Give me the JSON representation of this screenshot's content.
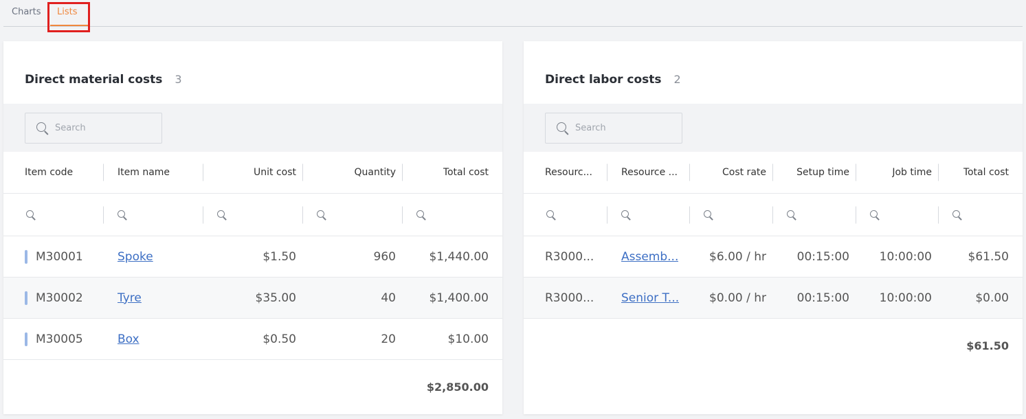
{
  "tabs": [
    {
      "label": "Charts",
      "active": false
    },
    {
      "label": "Lists",
      "active": true
    }
  ],
  "colors": {
    "accent": "#f0883e",
    "highlight": "#e0201f",
    "link": "#3d6fc4"
  },
  "material": {
    "title": "Direct material costs",
    "count": "3",
    "search_placeholder": "Search",
    "columns": [
      "Item code",
      "Item name",
      "Unit cost",
      "Quantity",
      "Total cost"
    ],
    "rows": [
      {
        "code": "M30001",
        "name": "Spoke",
        "unit_cost": "$1.50",
        "quantity": "960",
        "total": "$1,440.00"
      },
      {
        "code": "M30002",
        "name": "Tyre",
        "unit_cost": "$35.00",
        "quantity": "40",
        "total": "$1,400.00"
      },
      {
        "code": "M30005",
        "name": "Box",
        "unit_cost": "$0.50",
        "quantity": "20",
        "total": "$10.00"
      }
    ],
    "grand_total": "$2,850.00"
  },
  "labor": {
    "title": "Direct labor costs",
    "count": "2",
    "search_placeholder": "Search",
    "columns": [
      "Resourc...",
      "Resource ...",
      "Cost rate",
      "Setup time",
      "Job time",
      "Total cost"
    ],
    "rows": [
      {
        "code": "R3000...",
        "name": "Assemb...",
        "rate": "$6.00 / hr",
        "setup": "00:15:00",
        "job": "10:00:00",
        "total": "$61.50"
      },
      {
        "code": "R3000...",
        "name": "Senior T...",
        "rate": "$0.00 / hr",
        "setup": "00:15:00",
        "job": "10:00:00",
        "total": "$0.00"
      }
    ],
    "grand_total": "$61.50"
  }
}
